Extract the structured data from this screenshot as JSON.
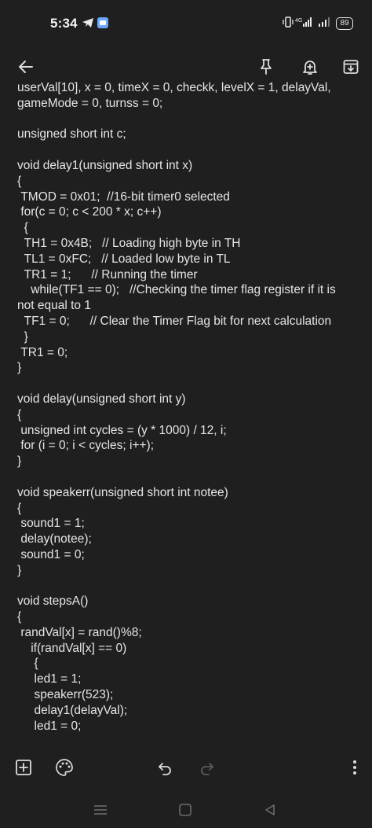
{
  "status_bar": {
    "time": "5:34",
    "battery": "89",
    "network": "4G"
  },
  "header": {
    "back_icon": "arrow-left-icon",
    "pin_icon": "pin-icon",
    "reminder_icon": "reminder-bell-icon",
    "archive_icon": "archive-icon"
  },
  "note": {
    "lines": [
      "userVal[10], x = 0, timeX = 0, checkk, levelX = 1, delayVal,",
      "gameMode = 0, turnss = 0;",
      "",
      "unsigned short int c;",
      "",
      "void delay1(unsigned short int x)",
      "{",
      " TMOD = 0x01;  //16-bit timer0 selected",
      " for(c = 0; c < 200 * x; c++)",
      "  {",
      "  TH1 = 0x4B;   // Loading high byte in TH",
      "  TL1 = 0xFC;   // Loaded low byte in TL",
      "  TR1 = 1;      // Running the timer",
      "    while(TF1 == 0);   //Checking the timer flag register if it is",
      "not equal to 1",
      "  TF1 = 0;      // Clear the Timer Flag bit for next calculation",
      "  }",
      " TR1 = 0;",
      "}",
      "",
      "void delay(unsigned short int y)",
      "{",
      " unsigned int cycles = (y * 1000) / 12, i;",
      " for (i = 0; i < cycles; i++);",
      "}",
      "",
      "void speakerr(unsigned short int notee)",
      "{",
      " sound1 = 1;",
      " delay(notee);",
      " sound1 = 0;",
      "}",
      "",
      "void stepsA()",
      "{",
      " randVal[x] = rand()%8;",
      "    if(randVal[x] == 0)",
      "     {",
      "     led1 = 1;",
      "     speakerr(523);",
      "     delay1(delayVal);",
      "     led1 = 0;"
    ]
  },
  "bottom_bar": {
    "add_icon": "add-box-icon",
    "palette_icon": "palette-icon",
    "undo_icon": "undo-icon",
    "redo_icon": "redo-icon",
    "more_icon": "more-vert-icon"
  },
  "nav_bar": {
    "menu_icon": "recent-apps-icon",
    "home_icon": "home-icon",
    "back_icon": "back-triangle-icon"
  },
  "colors": {
    "background": "#1f1f1f",
    "text": "#e5e5e5",
    "icon": "#dcdcdc",
    "dim_icon": "#5c5c5c"
  }
}
